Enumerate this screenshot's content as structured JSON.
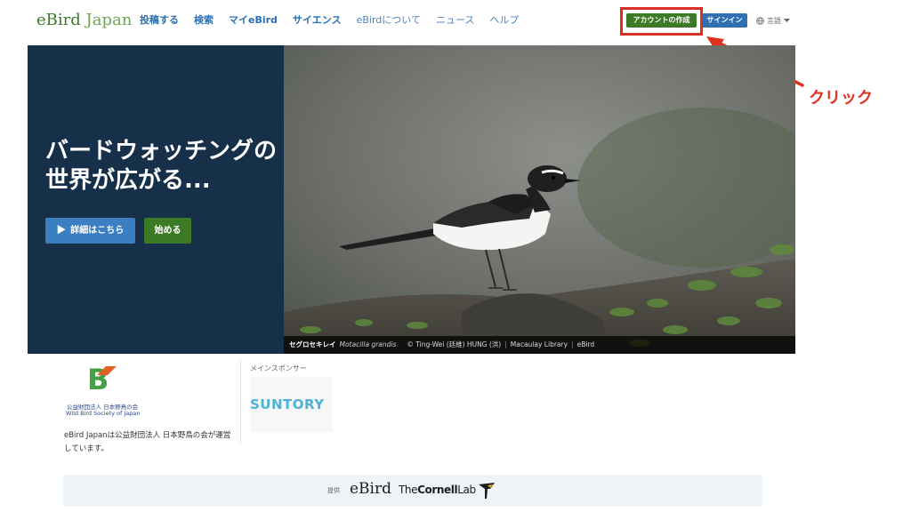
{
  "header": {
    "logo_ebird": "eBird",
    "logo_japan": "Japan",
    "nav": [
      {
        "label": "投稿する"
      },
      {
        "label": "検索"
      },
      {
        "label": "マイeBird"
      },
      {
        "label": "サイエンス"
      },
      {
        "label": "eBirdについて"
      },
      {
        "label": "ニュース"
      },
      {
        "label": "ヘルプ"
      }
    ],
    "create_account_label": "アカウントの作成",
    "signin_label": "サインイン",
    "language_label": "言語",
    "language_icon": "globe-icon"
  },
  "annotation": {
    "label": "クリック",
    "color": "#e0301e"
  },
  "hero": {
    "title": "バードウォッチングの世界が広がる...",
    "details_button": "詳細はこちら",
    "start_button": "始める",
    "caption": {
      "species": "セグロセキレイ",
      "scientific": "Motacilla grandis",
      "credit": "© Ting-Wei (廷維) HUNG (洪)",
      "library": "Macaulay Library",
      "source": "eBird"
    }
  },
  "org": {
    "logo_letter": "B",
    "logo_text_ja": "公益財団法人 日本野鳥の会",
    "logo_text_en": "Wild Bird Society of Japan",
    "operated_text": "eBird Japanは公益財団法人 日本野鳥の会が運営しています。"
  },
  "sponsor": {
    "label": "メインスポンサー",
    "name": "SUNTORY"
  },
  "footer": {
    "provided_label": "提供",
    "ebird": "eBird",
    "cornell_the": "The",
    "cornell_name": "Cornell",
    "cornell_lab": "Lab"
  },
  "colors": {
    "nav_blue": "#2c6fb0",
    "green": "#3d7a26",
    "hero_navy": "#173049",
    "signin_blue": "#2f6fb4"
  }
}
